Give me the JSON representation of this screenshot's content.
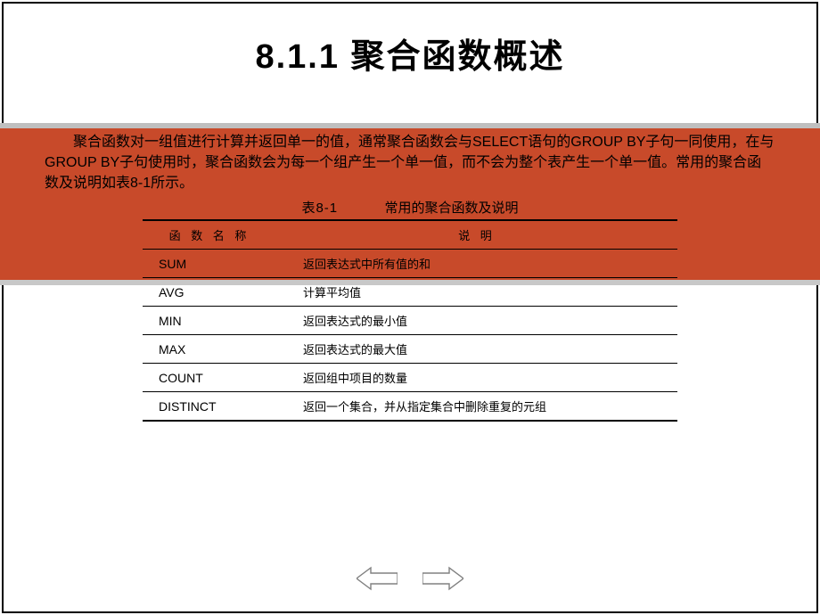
{
  "title": "8.1.1  聚合函数概述",
  "paragraph": "聚合函数对一组值进行计算并返回单一的值，通常聚合函数会与SELECT语句的GROUP BY子句一同使用，在与GROUP BY子句使用时，聚合函数会为每一个组产生一个单一值，而不会为整个表产生一个单一值。常用的聚合函数及说明如表8-1所示。",
  "table_caption_id": "表8-1",
  "table_caption_text": "常用的聚合函数及说明",
  "table": {
    "header_name": "函 数 名 称",
    "header_desc": "说 明",
    "rows": [
      {
        "name": "SUM",
        "desc": "返回表达式中所有值的和"
      },
      {
        "name": "AVG",
        "desc": "计算平均值"
      },
      {
        "name": "MIN",
        "desc": "返回表达式的最小值"
      },
      {
        "name": "MAX",
        "desc": "返回表达式的最大值"
      },
      {
        "name": "COUNT",
        "desc": "返回组中项目的数量"
      },
      {
        "name": "DISTINCT",
        "desc": "返回一个集合，并从指定集合中删除重复的元组"
      }
    ]
  },
  "nav": {
    "prev": "previous",
    "next": "next"
  },
  "colors": {
    "orange": "#c84a2a",
    "grey": "#bfbfbf"
  }
}
